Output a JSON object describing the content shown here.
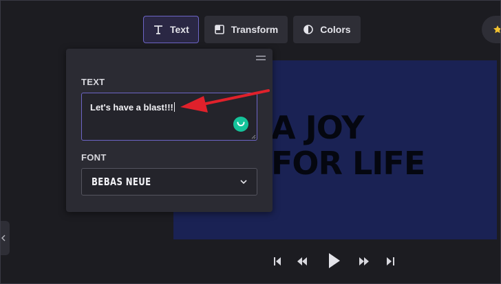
{
  "toolbar": {
    "items": [
      {
        "label": "Text",
        "icon": "text-icon",
        "active": true
      },
      {
        "label": "Transform",
        "icon": "transform-icon",
        "active": false
      },
      {
        "label": "Colors",
        "icon": "colors-icon",
        "active": false
      }
    ]
  },
  "panel": {
    "text_label": "TEXT",
    "text_value": "Let's have a blast!!!",
    "font_label": "FONT",
    "font_value": "BEBAS NEUE"
  },
  "preview": {
    "line1": "A JOY",
    "line2": "FOR LIFE",
    "background": "#1a2254"
  },
  "colors": {
    "accent": "#6e66c8",
    "annotation_arrow": "#e0212b",
    "grammarly": "#15c39a"
  }
}
